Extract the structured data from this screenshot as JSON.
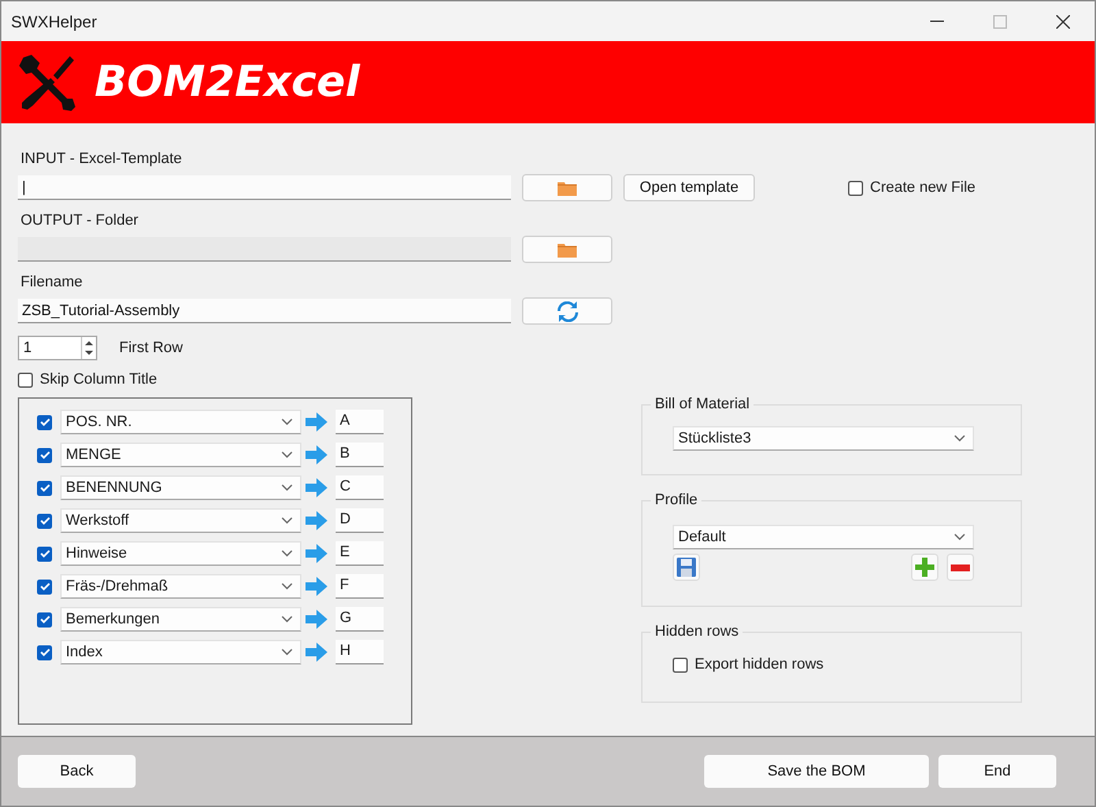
{
  "window": {
    "title": "SWXHelper"
  },
  "banner": {
    "title": "BOM2Excel"
  },
  "input": {
    "label": "INPUT - Excel-Template",
    "value": "|",
    "open_button": "Open template"
  },
  "create_new_file": {
    "label": "Create new File",
    "checked": false
  },
  "output": {
    "label": "OUTPUT - Folder",
    "disabled": true
  },
  "filename": {
    "label": "Filename",
    "value": "ZSB_Tutorial-Assembly"
  },
  "first_row": {
    "value": "1",
    "label": "First Row"
  },
  "skip_column_title": {
    "label": "Skip Column Title",
    "checked": false
  },
  "mappings": [
    {
      "checked": true,
      "property": "POS. NR.",
      "column": "A"
    },
    {
      "checked": true,
      "property": "MENGE",
      "column": "B"
    },
    {
      "checked": true,
      "property": "BENENNUNG",
      "column": "C"
    },
    {
      "checked": true,
      "property": "Werkstoff",
      "column": "D"
    },
    {
      "checked": true,
      "property": "Hinweise",
      "column": "E"
    },
    {
      "checked": true,
      "property": "Fräs-/Drehmaß",
      "column": "F"
    },
    {
      "checked": true,
      "property": "Bemerkungen",
      "column": "G"
    },
    {
      "checked": true,
      "property": "Index",
      "column": "H"
    }
  ],
  "bill_of_material": {
    "title": "Bill of Material",
    "value": "Stückliste3"
  },
  "profile": {
    "title": "Profile",
    "value": "Default"
  },
  "hidden_rows": {
    "title": "Hidden rows",
    "label": "Export hidden rows",
    "checked": false
  },
  "footer": {
    "back": "Back",
    "save": "Save the BOM",
    "end": "End"
  }
}
